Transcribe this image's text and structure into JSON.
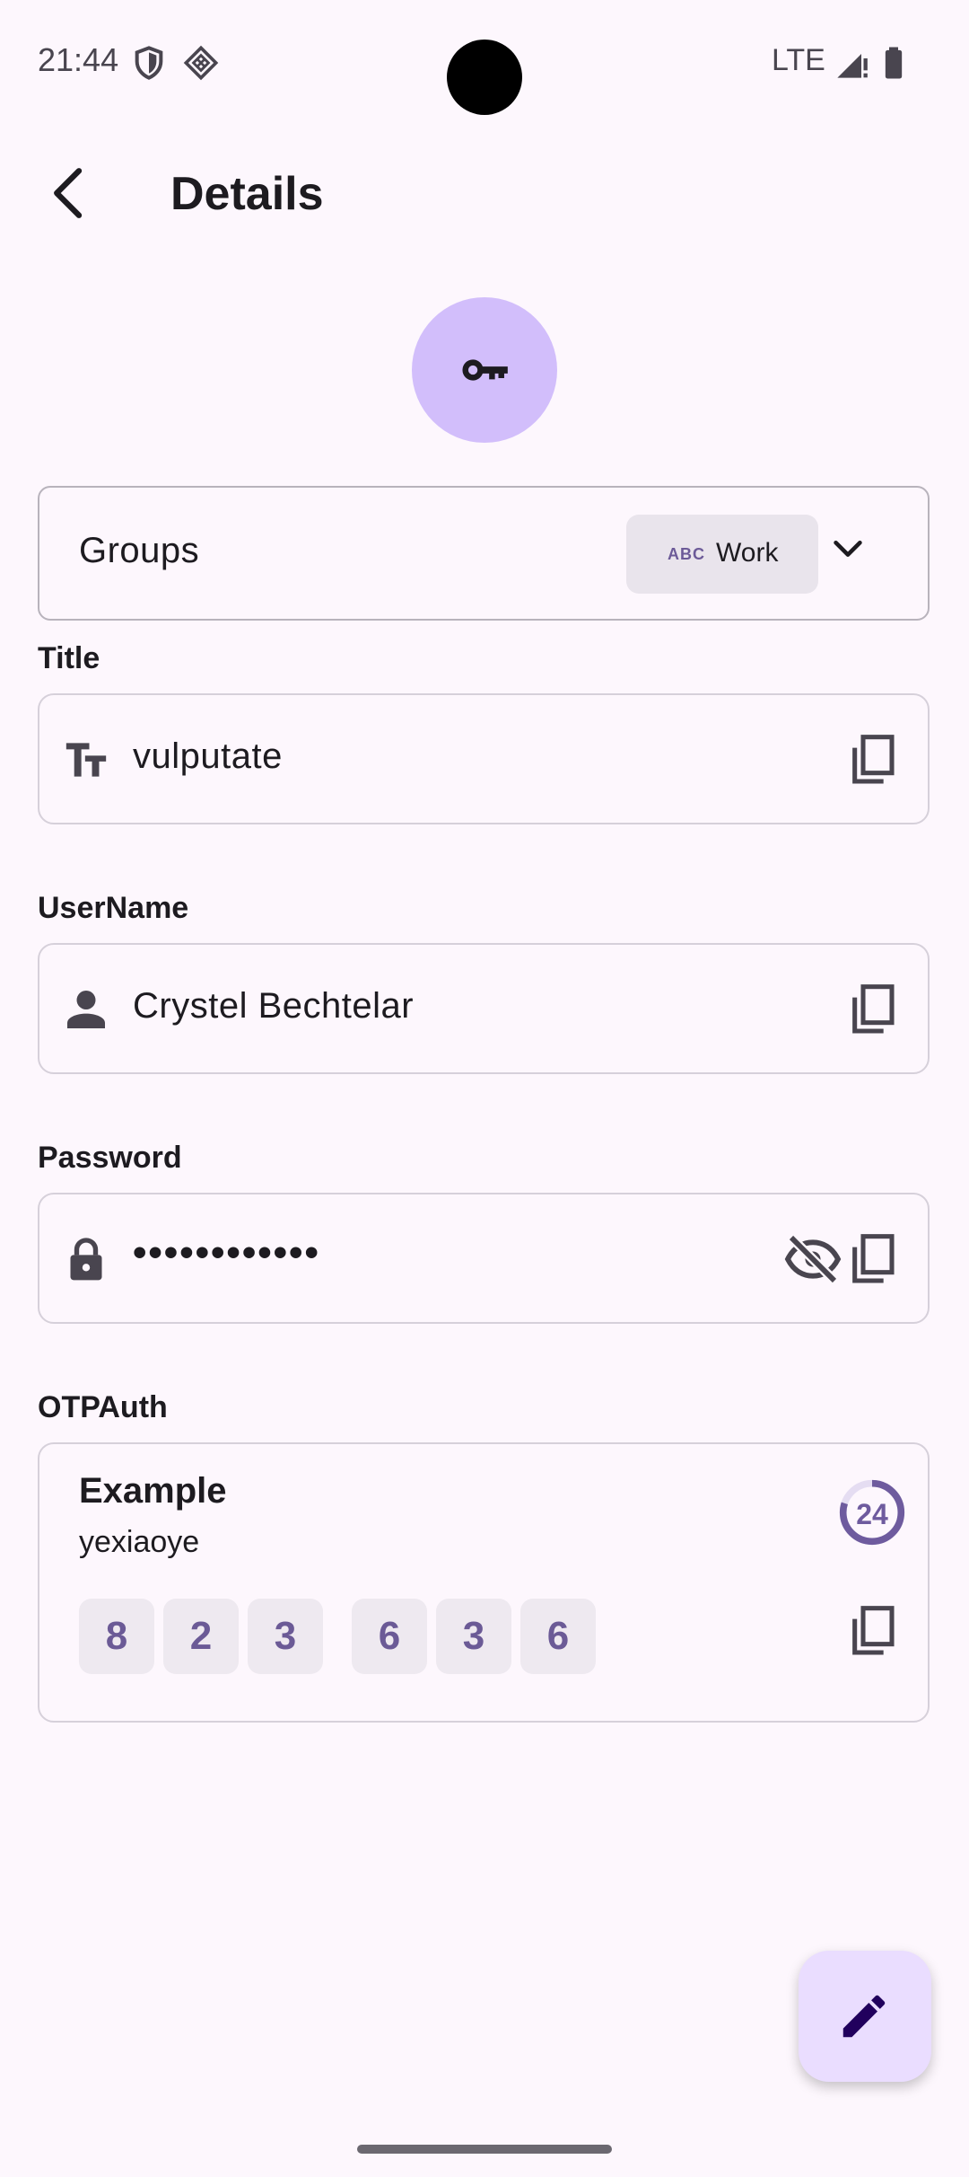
{
  "status_bar": {
    "time": "21:44",
    "network": "LTE"
  },
  "header": {
    "title": "Details"
  },
  "icons": {
    "back": "arrow-back-icon",
    "avatar": "key-icon",
    "groups_dropdown": "chevron-down-icon",
    "title": "text-fields-icon",
    "username": "person-icon",
    "password": "lock-icon",
    "visibility": "visibility-off-icon",
    "copy": "copy-icon",
    "fab": "edit-icon"
  },
  "groups": {
    "label": "Groups",
    "chip_prefix": "ABC",
    "chip_label": "Work"
  },
  "fields": {
    "title": {
      "label": "Title",
      "value": "vulputate"
    },
    "username": {
      "label": "UserName",
      "value": "Crystel Bechtelar"
    },
    "password": {
      "label": "Password",
      "value": "••••••••••••"
    }
  },
  "otp": {
    "label": "OTPAuth",
    "name": "Example",
    "account": "yexiaoye",
    "timer_seconds": "24",
    "timer_progress": 0.8,
    "digits": [
      "8",
      "2",
      "3",
      "6",
      "3",
      "6"
    ]
  },
  "colors": {
    "background": "#FDF7FD",
    "avatar": "#D2BEFB",
    "accent": "#6B5A96",
    "fab": "#EADDFF"
  }
}
